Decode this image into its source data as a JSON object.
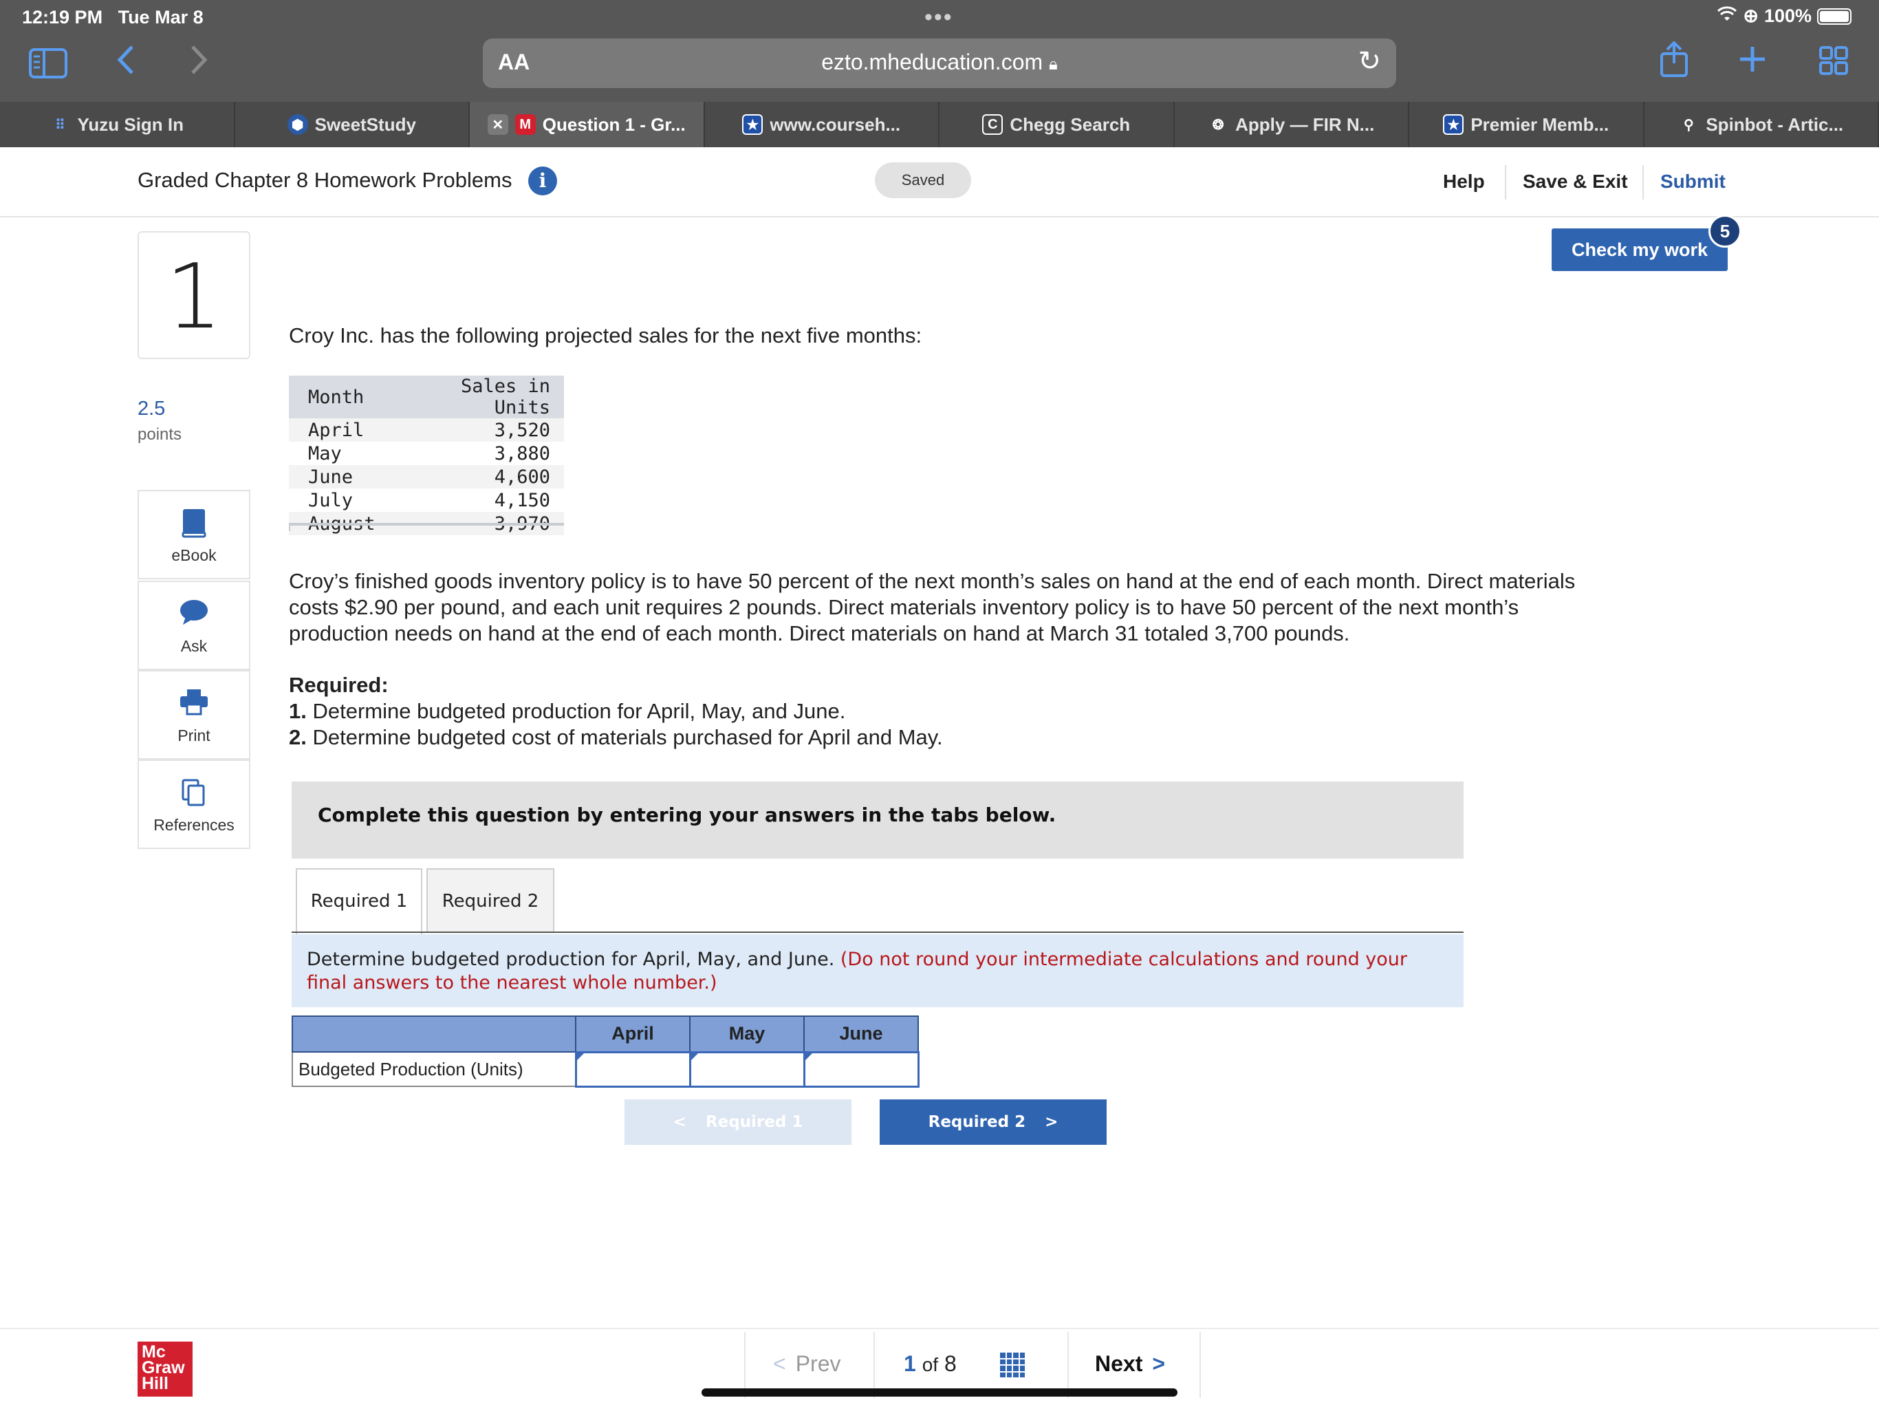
{
  "status_bar": {
    "time": "12:19 PM",
    "date": "Tue Mar 8",
    "battery": "100%"
  },
  "browser": {
    "aa_label": "AA",
    "url": "ezto.mheducation.com",
    "tabs": [
      {
        "label": "Yuzu Sign In",
        "icon": "yuzu-icon",
        "color": "#3d6fd1"
      },
      {
        "label": "SweetStudy",
        "icon": "sweetstudy-icon",
        "color": "#2b5aa6"
      },
      {
        "label": "Question 1 - Gr...",
        "icon": "mcgraw-m-icon",
        "color": "#d2202f",
        "active": true
      },
      {
        "label": "www.courseh...",
        "icon": "star-icon",
        "color": "#1f4fa6"
      },
      {
        "label": "Chegg Search",
        "icon": "chegg-icon",
        "color": "#333333"
      },
      {
        "label": "Apply — FIR N...",
        "icon": "globe-icon",
        "color": "#888888"
      },
      {
        "label": "Premier Memb...",
        "icon": "star-icon",
        "color": "#1f4fa6"
      },
      {
        "label": "Spinbot - Artic...",
        "icon": "bike-icon",
        "color": "#888888"
      }
    ]
  },
  "header": {
    "title": "Graded Chapter 8 Homework Problems",
    "saved": "Saved",
    "help": "Help",
    "save_exit": "Save & Exit",
    "submit": "Submit"
  },
  "question": {
    "number": "1",
    "points_value": "2.5",
    "points_label": "points",
    "check_my_work": "Check my work",
    "check_badge": "5",
    "intro": "Croy Inc. has the following projected sales for the next five months:",
    "sales_headers": [
      "Month",
      "Sales in Units"
    ],
    "sales_rows": [
      {
        "month": "April",
        "units": "3,520"
      },
      {
        "month": "May",
        "units": "3,880"
      },
      {
        "month": "June",
        "units": "4,600"
      },
      {
        "month": "July",
        "units": "4,150"
      },
      {
        "month": "August",
        "units": "3,970"
      }
    ],
    "paragraph": "Croy’s finished goods inventory policy is to have 50 percent of the next month’s sales on hand at the end of each month. Direct materials costs $2.90 per pound, and each unit requires 2 pounds. Direct materials inventory policy is to have 50 percent of the next month’s production needs on hand at the end of each month. Direct materials on hand at March 31 totaled 3,700 pounds.",
    "required_title": "Required:",
    "req1_num": "1.",
    "req1_text": " Determine budgeted production for April, May, and June.",
    "req2_num": "2.",
    "req2_text": " Determine budgeted cost of materials purchased for April and May.",
    "instruction": "Complete this question by entering your answers in the tabs below.",
    "tabs": [
      "Required 1",
      "Required 2"
    ],
    "prompt_main": "Determine budgeted production for April, May, and June. ",
    "prompt_note": "(Do not round your intermediate calculations and round your final answers to the nearest whole number.)",
    "answer_headers": [
      "",
      "April",
      "May",
      "June"
    ],
    "answer_row_label": "Budgeted Production (Units)",
    "answer_values": [
      "",
      "",
      ""
    ],
    "prev_btn": "Required 1",
    "next_btn": "Required 2"
  },
  "tools": [
    {
      "label": "eBook",
      "icon": "book-icon"
    },
    {
      "label": "Ask",
      "icon": "chat-icon"
    },
    {
      "label": "Print",
      "icon": "printer-icon"
    },
    {
      "label": "References",
      "icon": "copy-icon"
    }
  ],
  "footer": {
    "logo_lines": [
      "Mc",
      "Graw",
      "Hill"
    ],
    "prev": "Prev",
    "current_page": "1",
    "of_text": "of",
    "total_pages": "8",
    "next": "Next"
  },
  "colors": {
    "accent": "#2f64b0",
    "note_red": "#b8161b",
    "chrome": "#575757"
  }
}
